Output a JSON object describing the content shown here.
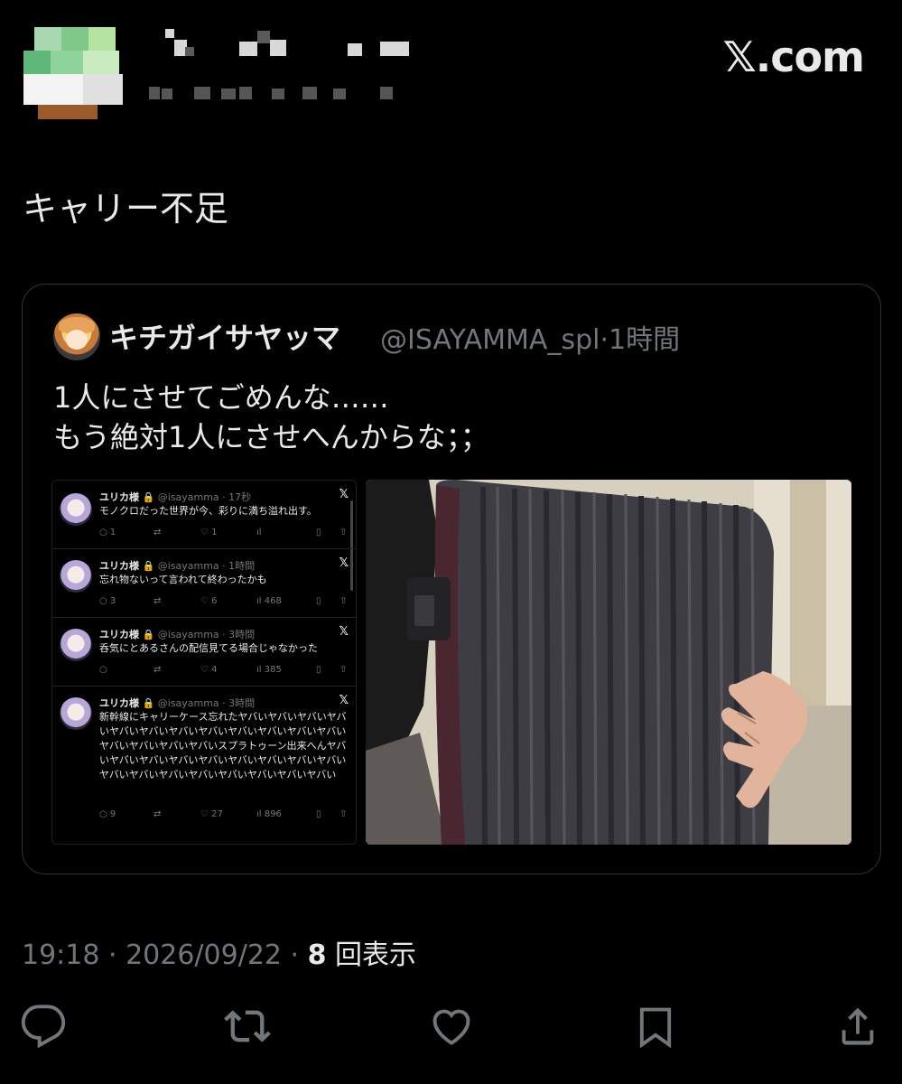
{
  "header": {
    "brand": "𝕏.com"
  },
  "tweet": {
    "text": "キャリー不足",
    "time": "19:18",
    "sep1": " · ",
    "date": "2026/09/22",
    "sep2": " · ",
    "views_count": "8",
    "views_label": "回表示"
  },
  "quote": {
    "name": "キチガイサヤッマ",
    "handle": "@ISAYAMMA_spl",
    "time": "·1時間",
    "text_line1": "1人にさせてごめんな……",
    "text_line2": "もう絶対1人にさせへんからな；；"
  },
  "inner_tweets": [
    {
      "name": "ユリカ様",
      "meta": "@isayamma · 17秒",
      "x": "𝕏",
      "body": "モノクロだった世界が今、彩りに満ち溢れ出す。",
      "reply": "1",
      "retweet": "",
      "like": "1",
      "views": ""
    },
    {
      "name": "ユリカ様",
      "meta": "@isayamma · 1時間",
      "x": "𝕏",
      "body": "忘れ物ないって言われて終わったかも",
      "reply": "3",
      "retweet": "",
      "like": "6",
      "views": "468"
    },
    {
      "name": "ユリカ様",
      "meta": "@isayamma · 3時間",
      "x": "𝕏",
      "body": "呑気にとあるさんの配信見てる場合じゃなかった",
      "reply": "",
      "retweet": "",
      "like": "4",
      "views": "385"
    },
    {
      "name": "ユリカ様",
      "meta": "@isayamma · 3時間",
      "x": "𝕏",
      "body": "新幹線にキャリーケース忘れたヤバいヤバいヤバいヤバいヤバいヤバいヤバいヤバいヤバいヤバいヤバいヤバいヤバいヤバいヤバいヤバいスプラトゥーン出来へんヤバいヤバいヤバいヤバいヤバいヤバいヤバいヤバいヤバいヤバいヤバいヤバいヤバいヤバいヤバいヤバいヤバい",
      "reply": "9",
      "retweet": "",
      "like": "27",
      "views": "896"
    }
  ],
  "icons": {
    "reply": "reply-icon",
    "retweet": "retweet-icon",
    "like": "heart-icon",
    "bookmark": "bookmark-icon",
    "share": "share-icon"
  },
  "colors": {
    "background": "#000000",
    "text": "#e7e9ea",
    "muted": "#71767b",
    "border": "#2f3336"
  }
}
